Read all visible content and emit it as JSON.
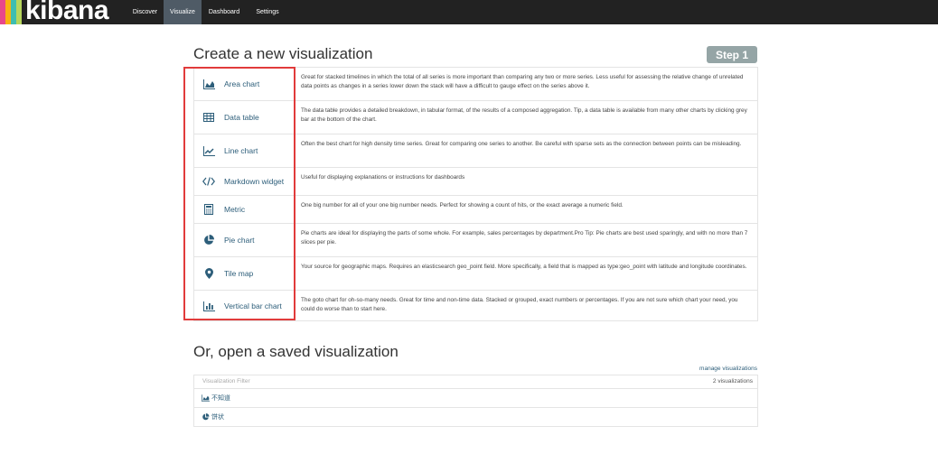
{
  "app": {
    "logo_text": "kibana",
    "logo_colors": [
      "#e8478b",
      "#f9b110",
      "#3ebeb0",
      "#b6d55c"
    ]
  },
  "nav": {
    "tabs": [
      {
        "label": "Discover",
        "active": false
      },
      {
        "label": "Visualize",
        "active": true
      },
      {
        "label": "Dashboard",
        "active": false
      },
      {
        "label": "Settings",
        "active": false
      }
    ]
  },
  "create": {
    "title": "Create a new visualization",
    "step": "Step 1",
    "types": [
      {
        "label": "Area chart",
        "icon": "area-chart-icon",
        "description": "Great for stacked timelines in which the total of all series is more important than comparing any two or more series. Less useful for assessing the relative change of unrelated data points as changes in a series lower down the stack will have a difficult to gauge effect on the series above it."
      },
      {
        "label": "Data table",
        "icon": "table-icon",
        "description": "The data table provides a detailed breakdown, in tabular format, of the results of a composed aggregation. Tip, a data table is available from many other charts by clicking grey bar at the bottom of the chart."
      },
      {
        "label": "Line chart",
        "icon": "line-chart-icon",
        "description": "Often the best chart for high density time series. Great for comparing one series to another. Be careful with sparse sets as the connection between points can be misleading."
      },
      {
        "label": "Markdown widget",
        "icon": "code-icon",
        "description": "Useful for displaying explanations or instructions for dashboards"
      },
      {
        "label": "Metric",
        "icon": "calculator-icon",
        "description": "One big number for all of your one big number needs. Perfect for showing a count of hits, or the exact average a numeric field."
      },
      {
        "label": "Pie chart",
        "icon": "pie-chart-icon",
        "description": "Pie charts are ideal for displaying the parts of some whole. For example, sales percentages by department.Pro Tip: Pie charts are best used sparingly, and with no more than 7 slices per pie."
      },
      {
        "label": "Tile map",
        "icon": "map-marker-icon",
        "description": "Your source for geographic maps. Requires an elasticsearch geo_point field. More specifically, a field that is mapped as type:geo_point with latitude and longitude coordinates."
      },
      {
        "label": "Vertical bar chart",
        "icon": "bar-chart-icon",
        "description": "The goto chart for oh-so-many needs. Great for time and non-time data. Stacked or grouped, exact numbers or percentages. If you are not sure which chart your need, you could do worse than to start here."
      }
    ]
  },
  "saved": {
    "title": "Or, open a saved visualization",
    "manage_link": "manage visualizations",
    "filter_placeholder": "Visualization Filter",
    "count": "2 visualizations",
    "items": [
      {
        "label": "不知道",
        "icon": "area-chart-icon"
      },
      {
        "label": "饼状",
        "icon": "pie-chart-icon"
      }
    ]
  }
}
